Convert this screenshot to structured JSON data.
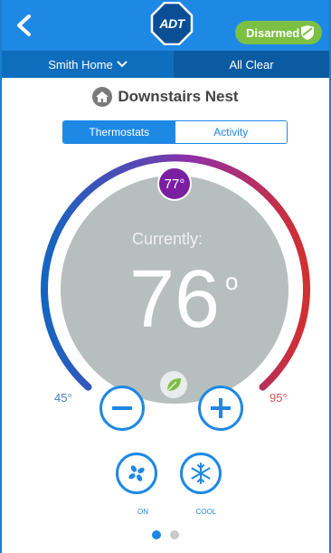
{
  "header": {
    "logo_text": "ADT",
    "status_button": "Disarmed"
  },
  "subbar": {
    "location": "Smith Home",
    "status": "All Clear"
  },
  "device": {
    "title": "Downstairs Nest"
  },
  "tabs": [
    {
      "label": "Thermostats",
      "active": true
    },
    {
      "label": "Activity",
      "active": false
    }
  ],
  "thermostat": {
    "current_label": "Currently:",
    "current_temp": "76",
    "degree_symbol": "o",
    "setpoint": "77°",
    "min_temp": "45°",
    "max_temp": "95°"
  },
  "modes": [
    {
      "label": "ON",
      "icon": "fan-icon"
    },
    {
      "label": "COOL",
      "icon": "snowflake-icon"
    }
  ],
  "pager": {
    "pages": 2,
    "current": 1
  },
  "colors": {
    "header_blue": "#1e88e5",
    "disarmed_green": "#7bc043",
    "dial_gray": "#b7bfbe",
    "setpoint_purple": "#7b1fa2",
    "arc_cold": "#1565c0",
    "arc_hot": "#d32f2f"
  }
}
